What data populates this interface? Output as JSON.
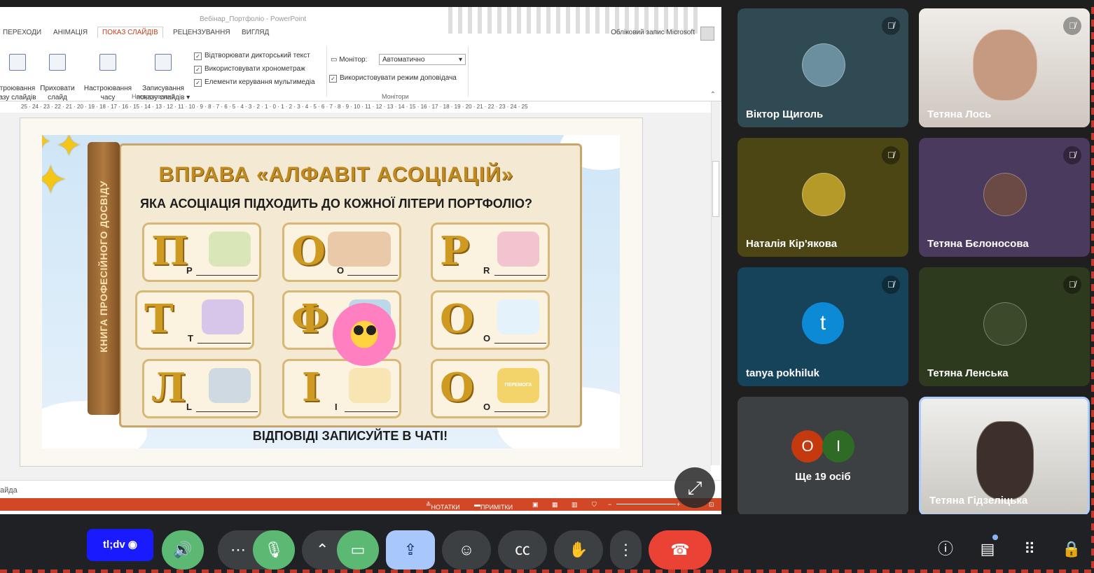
{
  "ppt": {
    "window_title": "Вебінар_Портфоліо - PowerPoint",
    "tabs": [
      "ПЕРЕХОДИ",
      "АНІМАЦІЯ",
      "ПОКАЗ СЛАЙДІВ",
      "РЕЦЕНЗУВАННЯ",
      "ВИГЛЯД"
    ],
    "active_tab": "ПОКАЗ СЛАЙДІВ",
    "account": "Обліковий запис Microsoft",
    "ribbon": {
      "btn_setup": "троювання\nазу слайдів",
      "btn_hide": "Приховати\nслайд",
      "btn_timing": "Настроювання\nчасу",
      "btn_record": "Записування\nпоказу слайдів ▾",
      "chk_narration": "Відтворювати дикторський текст",
      "chk_timings": "Використовувати хронометраж",
      "chk_media": "Елементи керування мультимедіа",
      "group_setup": "Настроювання",
      "monitor_label": "Монітор:",
      "monitor_value": "Автоматично",
      "chk_presenter": "Використовувати режим доповідача",
      "group_monitors": "Монітори"
    },
    "ruler": "25 · 24 · 23 · 22 · 21 · 20 · 19 · 18 · 17 · 16 · 15 · 14 · 13 · 12 · 11 · 10 · 9 · 8 · 7 · 6 · 5 · 4 · 3 · 2 · 1 · 0 · 1 · 2 · 3 · 4 · 5 · 6 · 7 · 8 · 9 · 10 · 11 · 12 · 13 · 14 · 15 · 16 · 17 · 18 · 19 · 20 · 21 · 22 · 23 · 24 · 25",
    "notes_placeholder": "айда",
    "status": {
      "notes": "НОТАТКИ",
      "comments": "ПРИМІТКИ"
    }
  },
  "slide": {
    "title": "ВПРАВА «АЛФАВІТ АСОЦІАЦІЙ»",
    "subtitle": "ЯКА АСОЦІАЦІЯ ПІДХОДИТЬ ДО КОЖНОЇ ЛІТЕРИ ПОРТФОЛІО?",
    "spine": "КНИГА ПРОФЕСІЙНОГО ДОСВІДУ",
    "footer": "ВІДПОВІДІ ЗАПИСУЙТЕ В ЧАТІ!",
    "cards": [
      {
        "big": "П",
        "small": "P"
      },
      {
        "big": "О",
        "small": "O"
      },
      {
        "big": "Р",
        "small": "R"
      },
      {
        "big": "Т",
        "small": "T"
      },
      {
        "big": "Ф",
        "small": ""
      },
      {
        "big": "О",
        "small": "O"
      },
      {
        "big": "Л",
        "small": "L"
      },
      {
        "big": "І",
        "small": "I"
      },
      {
        "big": "О",
        "small": "O"
      }
    ],
    "badge": "ПЕРЕМОГА"
  },
  "participants": [
    {
      "name": "Віктор Щиголь",
      "color": "#2f4a52"
    },
    {
      "name": "Тетяна Лось",
      "color": "#dcd6cf"
    },
    {
      "name": "Наталія Кір'якова",
      "color": "#4b4614"
    },
    {
      "name": "Тетяна Бєлоносова",
      "color": "#4a3a5e"
    },
    {
      "name": "tanya pokhiluk",
      "color": "#16425a",
      "letter": "t"
    },
    {
      "name": "Тетяна Ленська",
      "color": "#2e3a1d"
    },
    {
      "name": "Тетяна Гідзеліцька",
      "color": "#d8d6d2"
    }
  ],
  "more": {
    "bubbles": [
      "O",
      "I"
    ],
    "label": "Ще 19 осіб"
  },
  "controls": {
    "tldv": "tl;dv"
  }
}
